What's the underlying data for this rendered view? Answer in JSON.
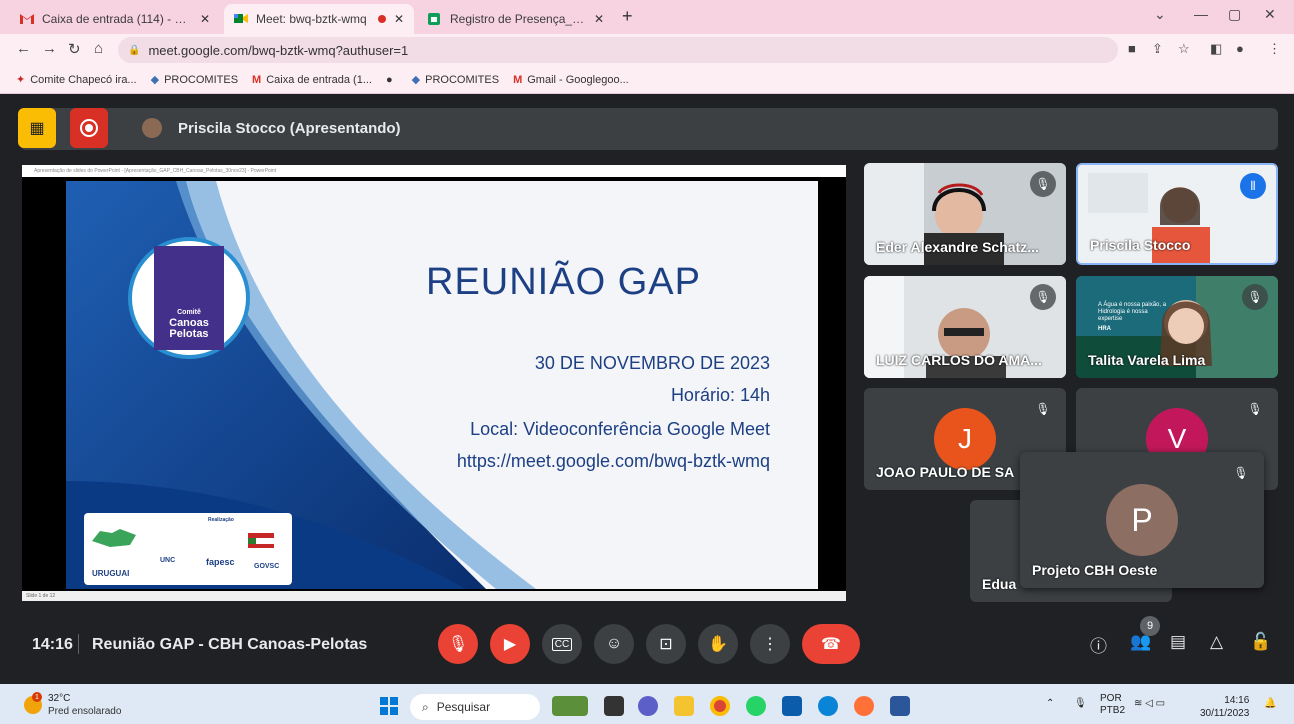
{
  "browser": {
    "tabs": [
      {
        "label": "Caixa de entrada (114) - projeto",
        "icon": "gmail-icon"
      },
      {
        "label": "Meet: bwq-bztk-wmq",
        "icon": "meet-icon",
        "recording": true
      },
      {
        "label": "Registro de Presença_Reunião d",
        "icon": "sheets-icon"
      }
    ],
    "url": "meet.google.com/bwq-bztk-wmq?authuser=1",
    "bookmarks": [
      {
        "label": "Comite Chapecó ira...",
        "icon": "bookmark-icon"
      },
      {
        "label": "PROCOMITES",
        "icon": "diamond-icon"
      },
      {
        "label": "Caixa de entrada (1...",
        "icon": "gmail-icon"
      },
      {
        "label": "",
        "icon": "globe-icon"
      },
      {
        "label": "PROCOMITES",
        "icon": "diamond-icon"
      },
      {
        "label": "Gmail - Googlegoo...",
        "icon": "gmail-icon"
      }
    ]
  },
  "meet": {
    "presenter": "Priscila Stocco (Apresentando)",
    "slide": {
      "window_title": "Apresentação de slides do PowerPoint - [Apresentação_GAP_CBH_Canoas_Pelotas_30nov23] - PowerPoint",
      "status": "Slide 1 de 12",
      "title": "REUNIÃO GAP",
      "date": "30 DE NOVEMBRO DE 2023",
      "time_label": "Horário: 14h",
      "place_label": "Local: Videoconferência Google Meet",
      "link": "https://meet.google.com/bwq-bztk-wmq",
      "logo_text": [
        "Comitê",
        "Canoas",
        "Pelotas"
      ],
      "footer": [
        "URUGUAI",
        "UNC",
        "fapesc",
        "GOVSC",
        "Realização"
      ]
    },
    "tiles": [
      {
        "name": "Eder Alexandre Schatz...",
        "muted": true
      },
      {
        "name": "Priscila Stocco",
        "speaking": true
      },
      {
        "name": "LUIZ CARLOS DO AMA...",
        "muted": true
      },
      {
        "name": "Talita Varela Lima",
        "muted": true
      },
      {
        "name": "JOAO PAULO DE SA",
        "initial": "J",
        "color": "#e8541c",
        "muted": true
      },
      {
        "name": "",
        "initial": "V",
        "color": "#c2185b",
        "muted": true
      },
      {
        "name": "Edua",
        "initial": "",
        "muted": false
      },
      {
        "name": "Projeto CBH Oeste",
        "initial": "P",
        "color": "#8d6e63",
        "muted": true
      }
    ],
    "tile_bg_text": [
      "A Água é nossa paixão, a Hidrologia é nossa expertise",
      "HRA"
    ],
    "time": "14:16",
    "meeting_title": "Reunião GAP - CBH Canoas-Pelotas",
    "participants_count": "9"
  },
  "taskbar": {
    "temperature": "32°C",
    "weather": "Pred ensolarado",
    "weather_badge": "1",
    "search": "Pesquisar",
    "lang": [
      "POR",
      "PTB2"
    ],
    "clock_time": "14:16",
    "clock_date": "30/11/2023"
  }
}
